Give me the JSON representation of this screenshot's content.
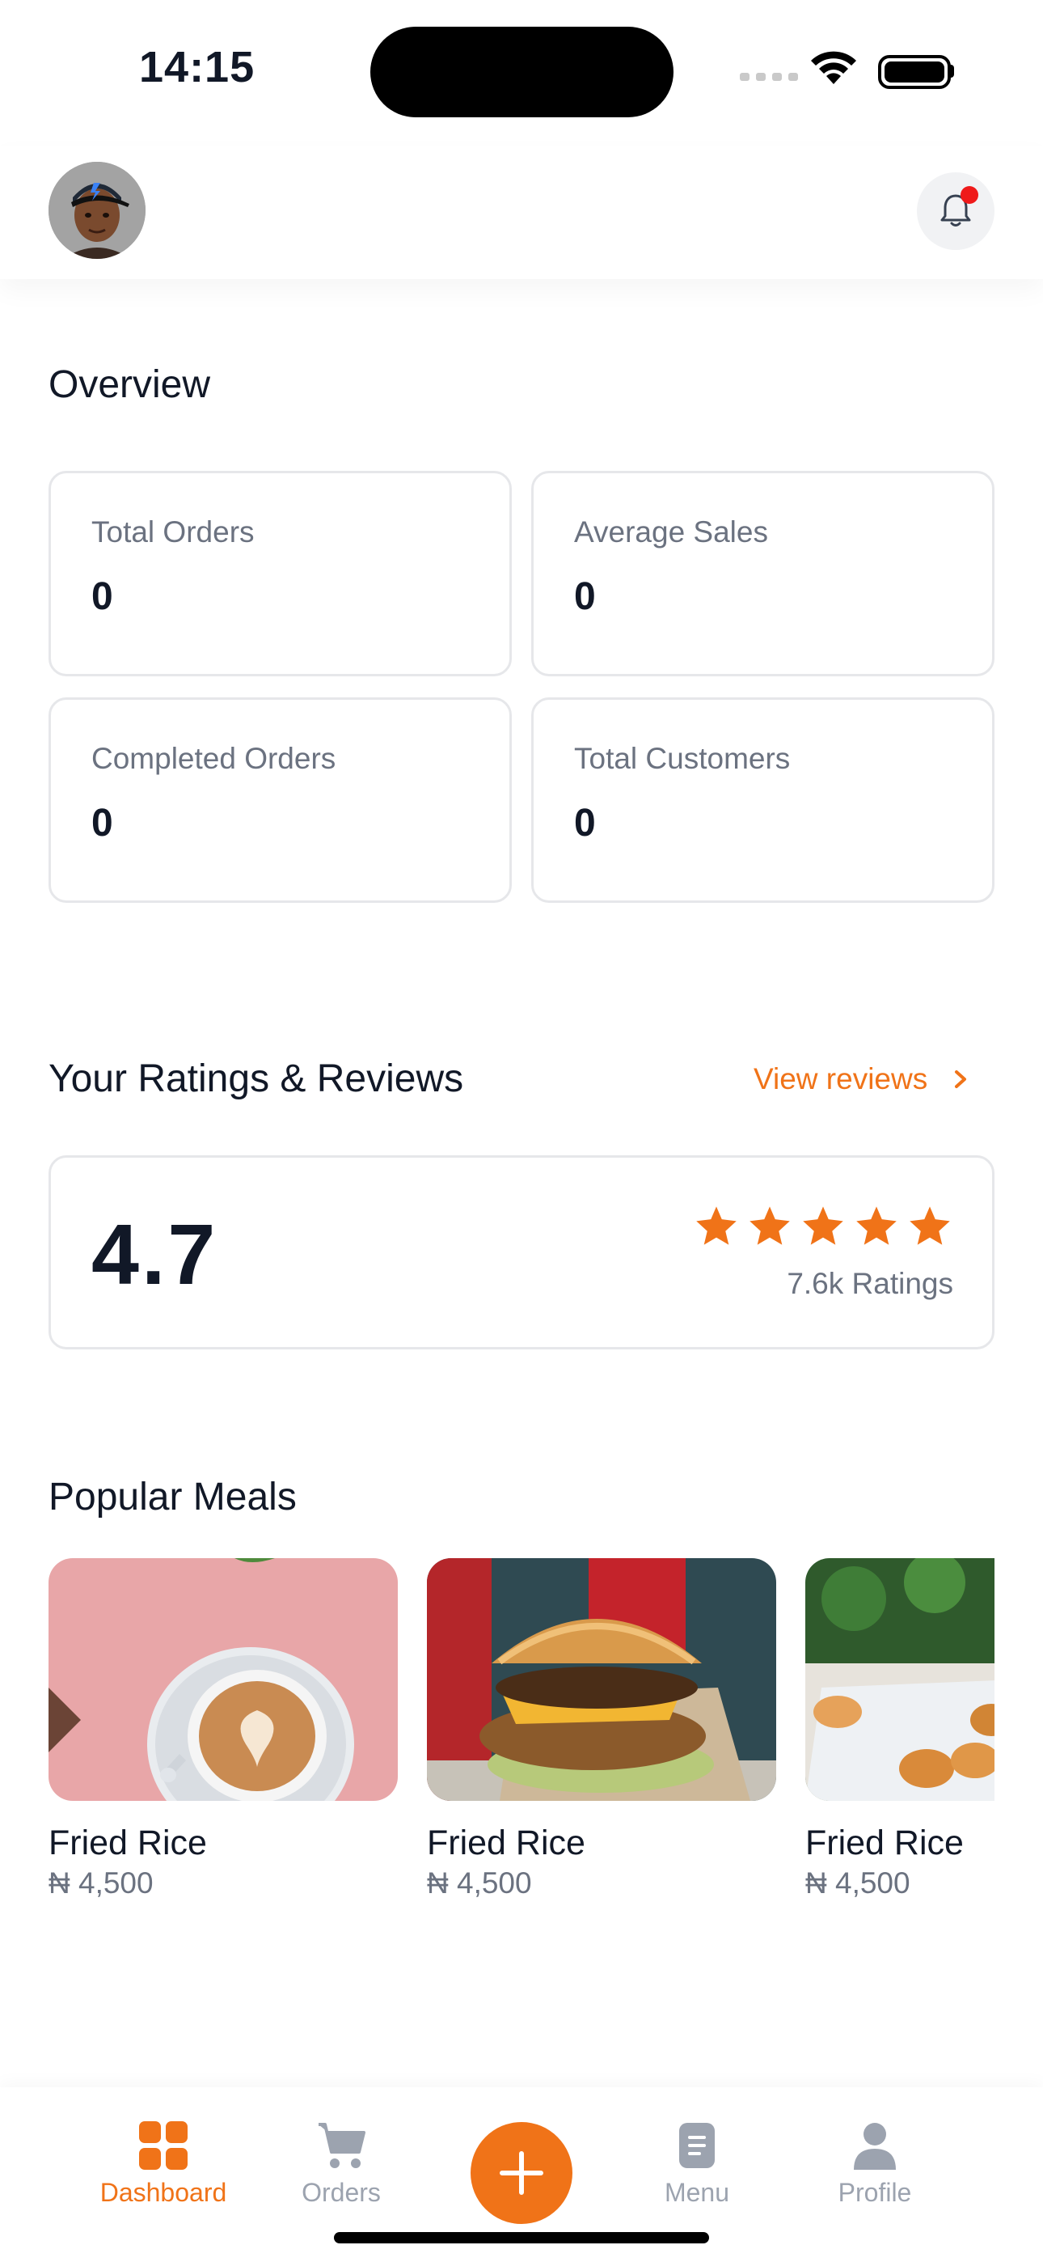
{
  "status_bar": {
    "time": "14:15"
  },
  "overview": {
    "title": "Overview",
    "stats": [
      {
        "label": "Total Orders",
        "value": "0"
      },
      {
        "label": "Average Sales",
        "value": "0"
      },
      {
        "label": "Completed Orders",
        "value": "0"
      },
      {
        "label": "Total Customers",
        "value": "0"
      }
    ]
  },
  "ratings": {
    "title": "Your Ratings & Reviews",
    "link_label": "View reviews",
    "score": "4.7",
    "stars": 5,
    "count_label": "7.6k Ratings"
  },
  "popular": {
    "title": "Popular Meals",
    "meals": [
      {
        "name": "Fried Rice",
        "price": "₦ 4,500"
      },
      {
        "name": "Fried Rice",
        "price": "₦ 4,500"
      },
      {
        "name": "Fried Rice",
        "price": "₦ 4,500"
      }
    ]
  },
  "tabbar": {
    "items": [
      {
        "label": "Dashboard"
      },
      {
        "label": "Orders"
      },
      {
        "label": "Menu"
      },
      {
        "label": "Profile"
      }
    ]
  },
  "colors": {
    "accent": "#f07318",
    "text": "#111827",
    "muted": "#6b7280",
    "border": "#e6e7ea"
  }
}
